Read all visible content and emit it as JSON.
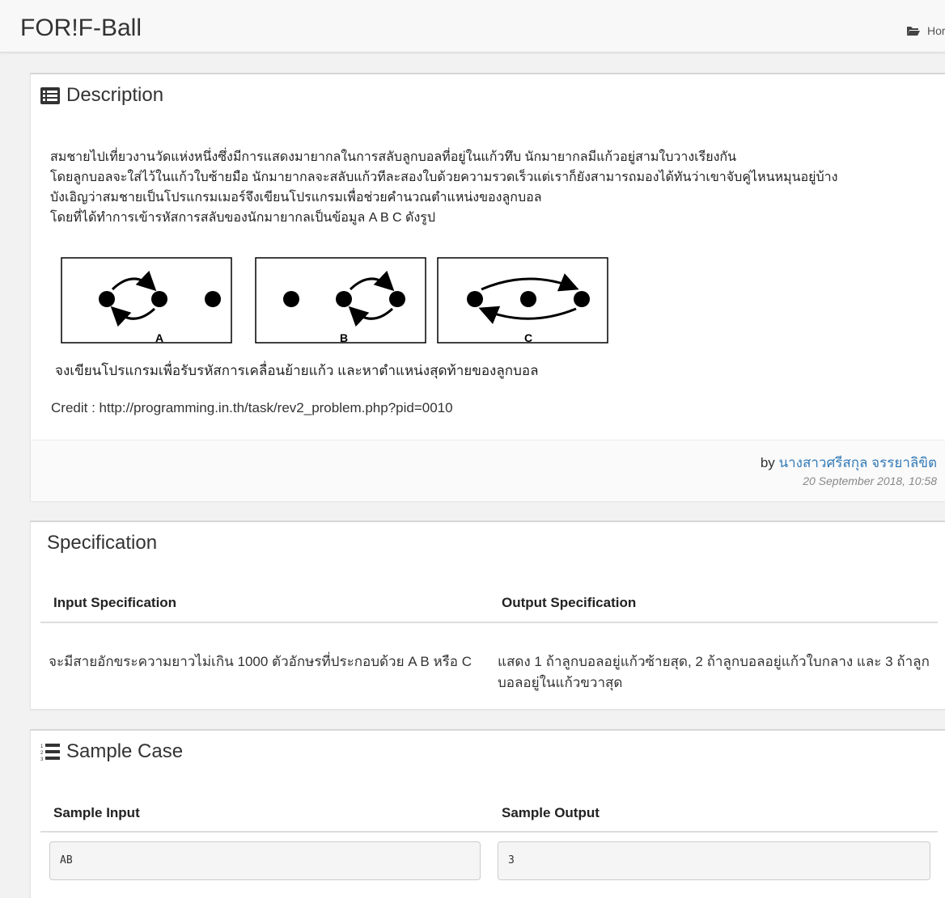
{
  "navbar": {
    "brand": "FOR!F-Ball",
    "breadcrumb_home": "Hor"
  },
  "description": {
    "title": "Description",
    "paragraph_lines": [
      "สมชายไปเที่ยวงานวัดแห่งหนึ่งซึ่งมีการแสดงมายากลในการสลับลูกบอลที่อยู่ในแก้วทึบ นักมายากลมีแก้วอยู่สามใบวางเรียงกัน",
      "โดยลูกบอลจะใส่ไว้ในแก้วใบซ้ายมือ นักมายากลจะสลับแก้วทีละสองใบด้วยความรวดเร็วแต่เราก็ยังสามารถมองได้ทันว่าเขาจับคู่ไหนหมุนอยู่บ้าง",
      "บังเอิญว่าสมชายเป็นโปรแกรมเมอร์จึงเขียนโปรแกรมเพื่อช่วยคำนวณตำแหน่งของลูกบอล",
      "โดยที่ได้ทำการเข้ารหัสการสลับของนักมายากลเป็นข้อมูล A B C ดังรูป"
    ],
    "figure_labels": [
      "A",
      "B",
      "C"
    ],
    "task_line": "จงเขียนโปรแกรมเพื่อรับรหัสการเคลื่อนย้ายแก้ว และหาตำแหน่งสุดท้ายของลูกบอล",
    "credit": "Credit : http://programming.in.th/task/rev2_problem.php?pid=0010",
    "by_label": "by",
    "author": "นางสาวศรีสกุล จรรยาลิขิต",
    "date": "20 September 2018, 10:58"
  },
  "specification": {
    "title": "Specification",
    "input_header": "Input Specification",
    "output_header": "Output Specification",
    "input_text": "จะมีสายอักขระความยาวไม่เกิน 1000 ตัวอักษรที่ประกอบด้วย A B หรือ C",
    "output_line1": "แสดง 1 ถ้าลูกบอลอยู่แก้วซ้ายสุด, 2 ถ้าลูกบอลอยู่แก้วใบกลาง และ 3 ถ้าลูก",
    "output_line2": "บอลอยู่ในแก้วขวาสุด"
  },
  "sample": {
    "title": "Sample Case",
    "input_header": "Sample Input",
    "output_header": "Sample Output",
    "input_value": "AB",
    "output_value": "3"
  }
}
